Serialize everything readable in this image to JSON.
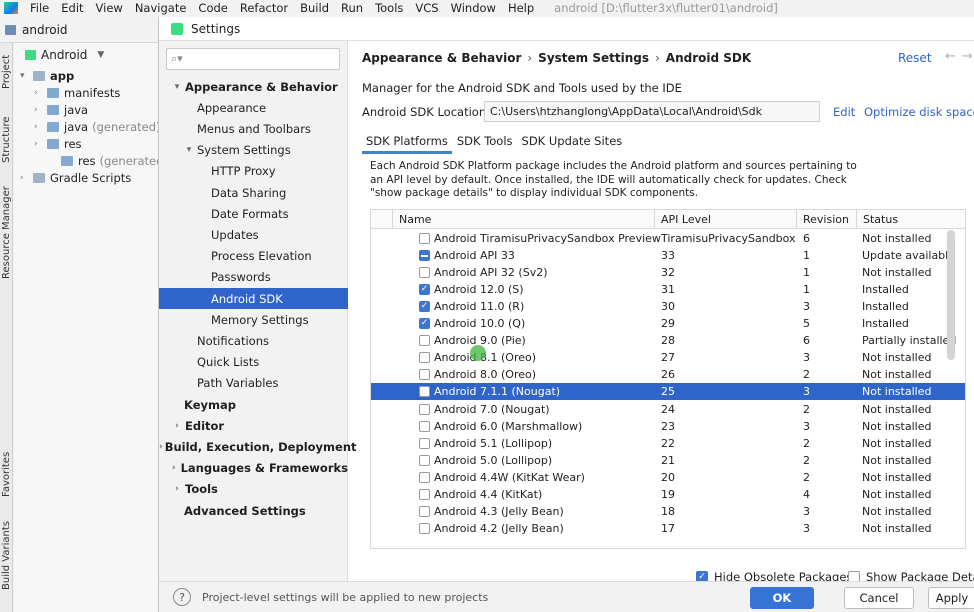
{
  "menubar": {
    "items": [
      "File",
      "Edit",
      "View",
      "Navigate",
      "Code",
      "Refactor",
      "Build",
      "Run",
      "Tools",
      "VCS",
      "Window",
      "Help"
    ],
    "project_path": "android [D:\\flutter3x\\flutter01\\android]"
  },
  "ide": {
    "project_name": "android",
    "tree_selector": "Android",
    "tree": [
      {
        "label": "app",
        "bold": true
      },
      {
        "label": "manifests"
      },
      {
        "label": "java"
      },
      {
        "label": "java",
        "suffix": "(generated)"
      },
      {
        "label": "res"
      },
      {
        "label": "res",
        "suffix": "(generated)"
      },
      {
        "label": "Gradle Scripts"
      }
    ],
    "left_tabs": [
      "Project",
      "Structure",
      "Resource Manager",
      "Favorites",
      "Build Variants"
    ]
  },
  "dialog": {
    "title": "Settings",
    "search_placeholder": "",
    "nav": [
      {
        "label": "Appearance & Behavior",
        "bold": true,
        "arrow": "open"
      },
      {
        "label": "Appearance"
      },
      {
        "label": "Menus and Toolbars"
      },
      {
        "label": "System Settings",
        "arrow": "open"
      },
      {
        "label": "HTTP Proxy"
      },
      {
        "label": "Data Sharing"
      },
      {
        "label": "Date Formats"
      },
      {
        "label": "Updates"
      },
      {
        "label": "Process Elevation"
      },
      {
        "label": "Passwords"
      },
      {
        "label": "Android SDK",
        "selected": true
      },
      {
        "label": "Memory Settings"
      },
      {
        "label": "Notifications"
      },
      {
        "label": "Quick Lists"
      },
      {
        "label": "Path Variables"
      },
      {
        "label": "Keymap",
        "bold": true
      },
      {
        "label": "Editor",
        "bold": true,
        "arrow": "closed"
      },
      {
        "label": "Build, Execution, Deployment",
        "bold": true,
        "arrow": "closed"
      },
      {
        "label": "Languages & Frameworks",
        "bold": true,
        "arrow": "closed"
      },
      {
        "label": "Tools",
        "bold": true,
        "arrow": "closed"
      },
      {
        "label": "Advanced Settings",
        "bold": true
      }
    ],
    "breadcrumb": [
      "Appearance & Behavior",
      "System Settings",
      "Android SDK"
    ],
    "reset_label": "Reset",
    "description": "Manager for the Android SDK and Tools used by the IDE",
    "sdk_location_label": "Android SDK Location:",
    "sdk_location_value": "C:\\Users\\htzhanglong\\AppData\\Local\\Android\\Sdk",
    "edit_label": "Edit",
    "optimize_label": "Optimize disk space",
    "tabs": [
      "SDK Platforms",
      "SDK Tools",
      "SDK Update Sites"
    ],
    "sdk_desc": "Each Android SDK Platform package includes the Android platform and sources pertaining to an API level by default. Once installed, the IDE will automatically check for updates. Check \"show package details\" to display individual SDK components.",
    "columns": [
      "Name",
      "API Level",
      "Revision",
      "Status"
    ],
    "rows": [
      {
        "name": "Android TiramisuPrivacySandbox Preview",
        "api": "TiramisuPrivacySandbox",
        "rev": "6",
        "status": "Not installed",
        "check": "off"
      },
      {
        "name": "Android API 33",
        "api": "33",
        "rev": "1",
        "status": "Update available",
        "check": "partial"
      },
      {
        "name": "Android API 32 (Sv2)",
        "api": "32",
        "rev": "1",
        "status": "Not installed",
        "check": "off"
      },
      {
        "name": "Android 12.0 (S)",
        "api": "31",
        "rev": "1",
        "status": "Installed",
        "check": "on"
      },
      {
        "name": "Android 11.0 (R)",
        "api": "30",
        "rev": "3",
        "status": "Installed",
        "check": "on"
      },
      {
        "name": "Android 10.0 (Q)",
        "api": "29",
        "rev": "5",
        "status": "Installed",
        "check": "on"
      },
      {
        "name": "Android 9.0 (Pie)",
        "api": "28",
        "rev": "6",
        "status": "Partially installed",
        "check": "off"
      },
      {
        "name": "Android 8.1 (Oreo)",
        "api": "27",
        "rev": "3",
        "status": "Not installed",
        "check": "off"
      },
      {
        "name": "Android 8.0 (Oreo)",
        "api": "26",
        "rev": "2",
        "status": "Not installed",
        "check": "off"
      },
      {
        "name": "Android 7.1.1 (Nougat)",
        "api": "25",
        "rev": "3",
        "status": "Not installed",
        "check": "off",
        "selected": true
      },
      {
        "name": "Android 7.0 (Nougat)",
        "api": "24",
        "rev": "2",
        "status": "Not installed",
        "check": "off"
      },
      {
        "name": "Android 6.0 (Marshmallow)",
        "api": "23",
        "rev": "3",
        "status": "Not installed",
        "check": "off"
      },
      {
        "name": "Android 5.1 (Lollipop)",
        "api": "22",
        "rev": "2",
        "status": "Not installed",
        "check": "off"
      },
      {
        "name": "Android 5.0 (Lollipop)",
        "api": "21",
        "rev": "2",
        "status": "Not installed",
        "check": "off"
      },
      {
        "name": "Android 4.4W (KitKat Wear)",
        "api": "20",
        "rev": "2",
        "status": "Not installed",
        "check": "off"
      },
      {
        "name": "Android 4.4 (KitKat)",
        "api": "19",
        "rev": "4",
        "status": "Not installed",
        "check": "off"
      },
      {
        "name": "Android 4.3 (Jelly Bean)",
        "api": "18",
        "rev": "3",
        "status": "Not installed",
        "check": "off"
      },
      {
        "name": "Android 4.2 (Jelly Bean)",
        "api": "17",
        "rev": "3",
        "status": "Not installed",
        "check": "off"
      }
    ],
    "hide_obsolete_label": "Hide Obsolete Packages",
    "hide_obsolete_checked": true,
    "show_details_label": "Show Package Details",
    "show_details_checked": false,
    "footer_note": "Project-level settings will be applied to new projects",
    "ok_label": "OK",
    "cancel_label": "Cancel",
    "apply_label": "Apply"
  },
  "colors": {
    "accent": "#2f65ca",
    "selection": "#2f65ca",
    "link": "#2f65ca"
  }
}
